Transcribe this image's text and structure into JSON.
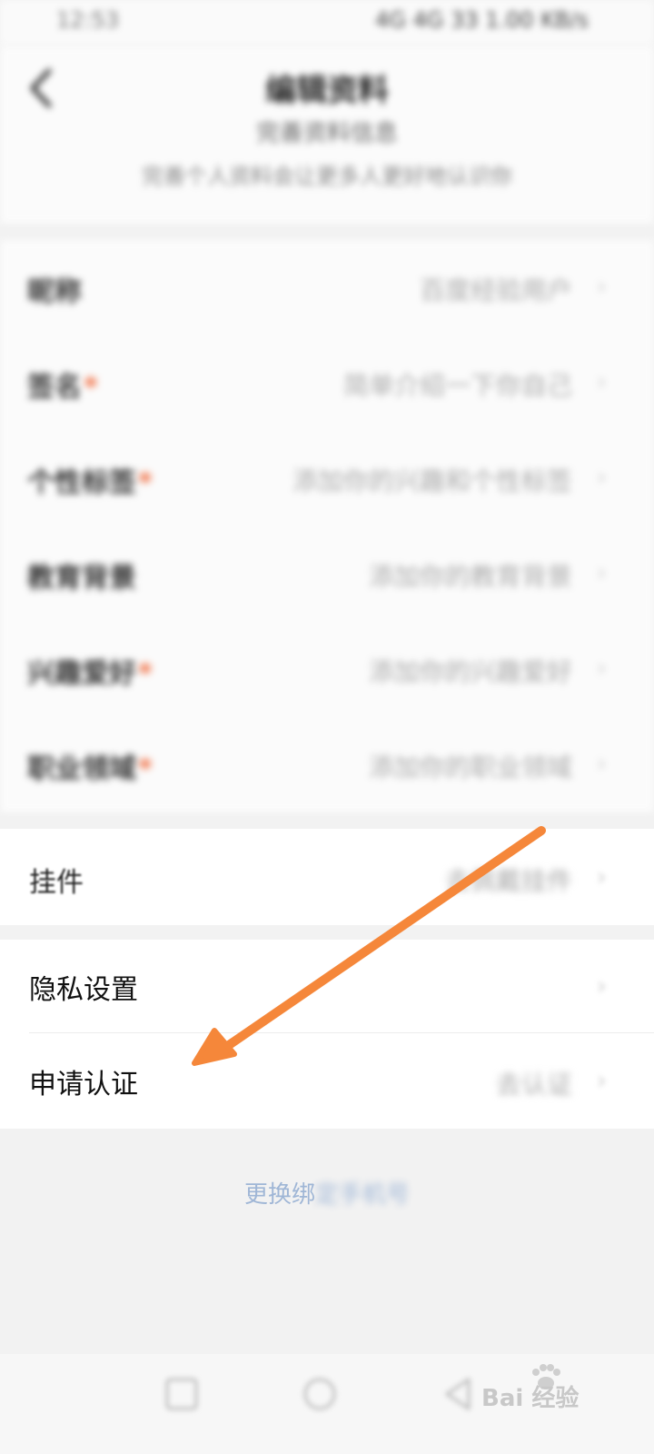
{
  "status_bar": {
    "time": "12:53",
    "indicators": "4G 4G 33 1.00 KB/s"
  },
  "header": {
    "title": "编辑资料",
    "subtitle": "完善资料信息",
    "description": "完善个人资料会让更多人更好地认识你"
  },
  "info_rows": [
    {
      "label": "昵称",
      "required": "",
      "value": "百度经验用户"
    },
    {
      "label": "签名",
      "required": "*",
      "value": "简单介绍一下你自己"
    },
    {
      "label": "个性标签",
      "required": "*",
      "value": "添加你的兴趣和个性标签"
    },
    {
      "label": "教育背景",
      "required": "",
      "value": "添加你的教育背景"
    },
    {
      "label": "兴趣爱好",
      "required": "*",
      "value": "添加你的兴趣爱好"
    },
    {
      "label": "职业领域",
      "required": "*",
      "value": "添加你的职业领域"
    }
  ],
  "pendant": {
    "label": "挂件",
    "value": "去佩戴挂件"
  },
  "settings": [
    {
      "label": "隐私设置",
      "value": ""
    },
    {
      "label": "申请认证",
      "value": "去认证"
    }
  ],
  "bind_link": {
    "visible": "更换绑",
    "blurred": "定手机号"
  },
  "chevron": "›",
  "watermark": {
    "text": "Bai 经验",
    "icon": "baidu-paw-icon"
  },
  "colors": {
    "accent_arrow": "#f5873a",
    "required_star": "#f06a3d",
    "link": "#9fb6d6"
  }
}
